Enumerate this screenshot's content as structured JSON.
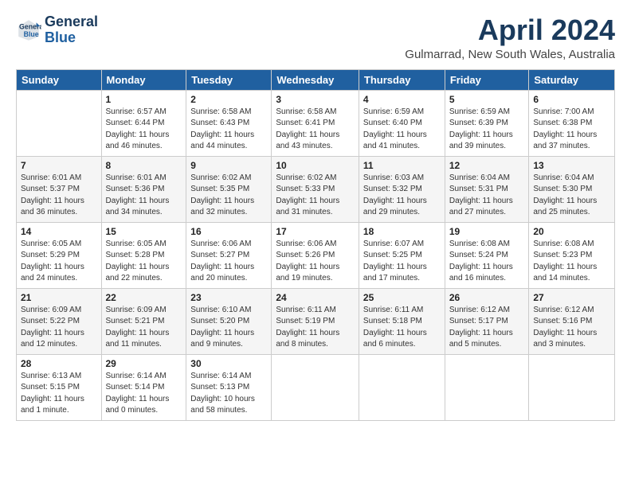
{
  "header": {
    "logo_line1": "General",
    "logo_line2": "Blue",
    "month_title": "April 2024",
    "location": "Gulmarrad, New South Wales, Australia"
  },
  "days_of_week": [
    "Sunday",
    "Monday",
    "Tuesday",
    "Wednesday",
    "Thursday",
    "Friday",
    "Saturday"
  ],
  "weeks": [
    [
      {
        "day": "",
        "info": ""
      },
      {
        "day": "1",
        "info": "Sunrise: 6:57 AM\nSunset: 6:44 PM\nDaylight: 11 hours\nand 46 minutes."
      },
      {
        "day": "2",
        "info": "Sunrise: 6:58 AM\nSunset: 6:43 PM\nDaylight: 11 hours\nand 44 minutes."
      },
      {
        "day": "3",
        "info": "Sunrise: 6:58 AM\nSunset: 6:41 PM\nDaylight: 11 hours\nand 43 minutes."
      },
      {
        "day": "4",
        "info": "Sunrise: 6:59 AM\nSunset: 6:40 PM\nDaylight: 11 hours\nand 41 minutes."
      },
      {
        "day": "5",
        "info": "Sunrise: 6:59 AM\nSunset: 6:39 PM\nDaylight: 11 hours\nand 39 minutes."
      },
      {
        "day": "6",
        "info": "Sunrise: 7:00 AM\nSunset: 6:38 PM\nDaylight: 11 hours\nand 37 minutes."
      }
    ],
    [
      {
        "day": "7",
        "info": "Sunrise: 6:01 AM\nSunset: 5:37 PM\nDaylight: 11 hours\nand 36 minutes."
      },
      {
        "day": "8",
        "info": "Sunrise: 6:01 AM\nSunset: 5:36 PM\nDaylight: 11 hours\nand 34 minutes."
      },
      {
        "day": "9",
        "info": "Sunrise: 6:02 AM\nSunset: 5:35 PM\nDaylight: 11 hours\nand 32 minutes."
      },
      {
        "day": "10",
        "info": "Sunrise: 6:02 AM\nSunset: 5:33 PM\nDaylight: 11 hours\nand 31 minutes."
      },
      {
        "day": "11",
        "info": "Sunrise: 6:03 AM\nSunset: 5:32 PM\nDaylight: 11 hours\nand 29 minutes."
      },
      {
        "day": "12",
        "info": "Sunrise: 6:04 AM\nSunset: 5:31 PM\nDaylight: 11 hours\nand 27 minutes."
      },
      {
        "day": "13",
        "info": "Sunrise: 6:04 AM\nSunset: 5:30 PM\nDaylight: 11 hours\nand 25 minutes."
      }
    ],
    [
      {
        "day": "14",
        "info": "Sunrise: 6:05 AM\nSunset: 5:29 PM\nDaylight: 11 hours\nand 24 minutes."
      },
      {
        "day": "15",
        "info": "Sunrise: 6:05 AM\nSunset: 5:28 PM\nDaylight: 11 hours\nand 22 minutes."
      },
      {
        "day": "16",
        "info": "Sunrise: 6:06 AM\nSunset: 5:27 PM\nDaylight: 11 hours\nand 20 minutes."
      },
      {
        "day": "17",
        "info": "Sunrise: 6:06 AM\nSunset: 5:26 PM\nDaylight: 11 hours\nand 19 minutes."
      },
      {
        "day": "18",
        "info": "Sunrise: 6:07 AM\nSunset: 5:25 PM\nDaylight: 11 hours\nand 17 minutes."
      },
      {
        "day": "19",
        "info": "Sunrise: 6:08 AM\nSunset: 5:24 PM\nDaylight: 11 hours\nand 16 minutes."
      },
      {
        "day": "20",
        "info": "Sunrise: 6:08 AM\nSunset: 5:23 PM\nDaylight: 11 hours\nand 14 minutes."
      }
    ],
    [
      {
        "day": "21",
        "info": "Sunrise: 6:09 AM\nSunset: 5:22 PM\nDaylight: 11 hours\nand 12 minutes."
      },
      {
        "day": "22",
        "info": "Sunrise: 6:09 AM\nSunset: 5:21 PM\nDaylight: 11 hours\nand 11 minutes."
      },
      {
        "day": "23",
        "info": "Sunrise: 6:10 AM\nSunset: 5:20 PM\nDaylight: 11 hours\nand 9 minutes."
      },
      {
        "day": "24",
        "info": "Sunrise: 6:11 AM\nSunset: 5:19 PM\nDaylight: 11 hours\nand 8 minutes."
      },
      {
        "day": "25",
        "info": "Sunrise: 6:11 AM\nSunset: 5:18 PM\nDaylight: 11 hours\nand 6 minutes."
      },
      {
        "day": "26",
        "info": "Sunrise: 6:12 AM\nSunset: 5:17 PM\nDaylight: 11 hours\nand 5 minutes."
      },
      {
        "day": "27",
        "info": "Sunrise: 6:12 AM\nSunset: 5:16 PM\nDaylight: 11 hours\nand 3 minutes."
      }
    ],
    [
      {
        "day": "28",
        "info": "Sunrise: 6:13 AM\nSunset: 5:15 PM\nDaylight: 11 hours\nand 1 minute."
      },
      {
        "day": "29",
        "info": "Sunrise: 6:14 AM\nSunset: 5:14 PM\nDaylight: 11 hours\nand 0 minutes."
      },
      {
        "day": "30",
        "info": "Sunrise: 6:14 AM\nSunset: 5:13 PM\nDaylight: 10 hours\nand 58 minutes."
      },
      {
        "day": "",
        "info": ""
      },
      {
        "day": "",
        "info": ""
      },
      {
        "day": "",
        "info": ""
      },
      {
        "day": "",
        "info": ""
      }
    ]
  ]
}
